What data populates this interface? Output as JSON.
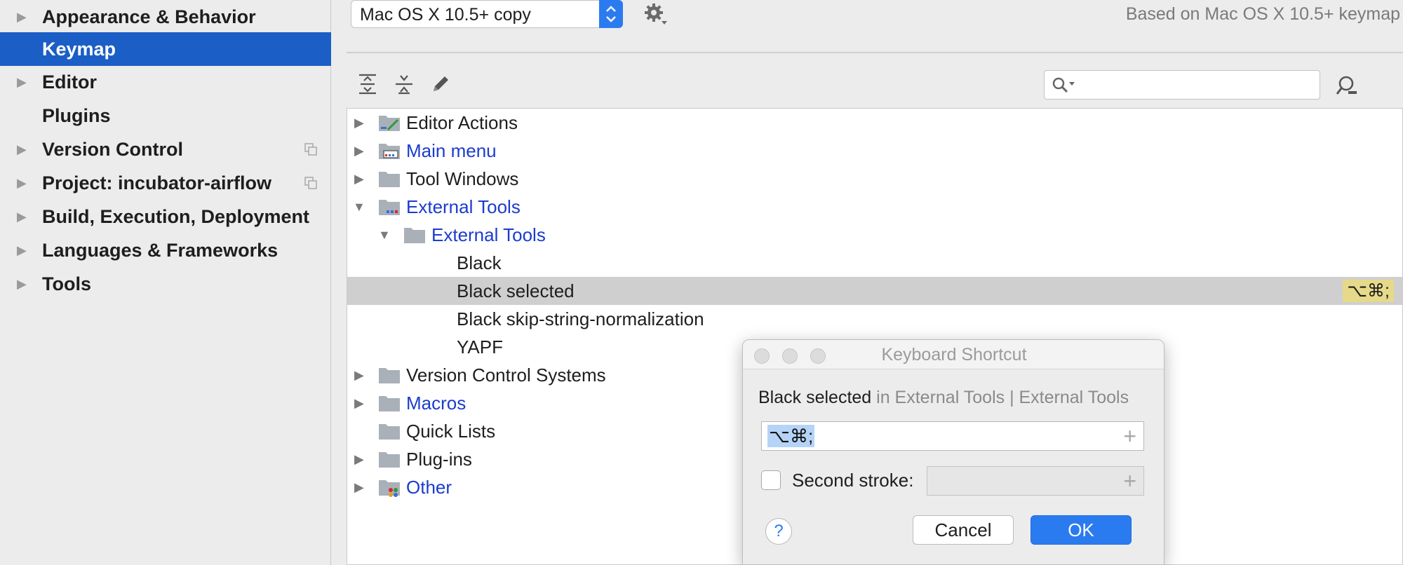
{
  "sidebar": {
    "items": [
      {
        "label": "Appearance & Behavior",
        "expandable": true,
        "selected": false
      },
      {
        "label": "Keymap",
        "expandable": false,
        "selected": true
      },
      {
        "label": "Editor",
        "expandable": true,
        "selected": false
      },
      {
        "label": "Plugins",
        "expandable": false,
        "selected": false
      },
      {
        "label": "Version Control",
        "expandable": true,
        "selected": false,
        "icon": "copy-icon"
      },
      {
        "label": "Project: incubator-airflow",
        "expandable": true,
        "selected": false,
        "icon": "copy-icon"
      },
      {
        "label": "Build, Execution, Deployment",
        "expandable": true,
        "selected": false
      },
      {
        "label": "Languages & Frameworks",
        "expandable": true,
        "selected": false
      },
      {
        "label": "Tools",
        "expandable": true,
        "selected": false
      }
    ]
  },
  "header": {
    "keymap_value": "Mac OS X 10.5+ copy",
    "based_on": "Based on Mac OS X 10.5+ keymap"
  },
  "toolbar": {
    "icons": [
      "expand-all-icon",
      "collapse-all-icon",
      "edit-icon"
    ],
    "search_value": ""
  },
  "tree": {
    "rows": [
      {
        "label": "Editor Actions",
        "link": false,
        "selected": false
      },
      {
        "label": "Main menu",
        "link": true,
        "selected": false
      },
      {
        "label": "Tool Windows",
        "link": false,
        "selected": false
      },
      {
        "label": "External Tools",
        "link": true,
        "selected": false
      },
      {
        "label": "External Tools",
        "link": true,
        "selected": false
      },
      {
        "label": "Black",
        "link": false,
        "selected": false
      },
      {
        "label": "Black selected",
        "link": false,
        "selected": true,
        "shortcut": "⌥⌘;"
      },
      {
        "label": "Black skip-string-normalization",
        "link": false,
        "selected": false
      },
      {
        "label": "YAPF",
        "link": false,
        "selected": false
      },
      {
        "label": "Version Control Systems",
        "link": false,
        "selected": false
      },
      {
        "label": "Macros",
        "link": true,
        "selected": false
      },
      {
        "label": "Quick Lists",
        "link": false,
        "selected": false
      },
      {
        "label": "Plug-ins",
        "link": false,
        "selected": false
      },
      {
        "label": "Other",
        "link": true,
        "selected": false
      }
    ]
  },
  "dialog": {
    "title": "Keyboard Shortcut",
    "action_name": "Black selected",
    "action_context": " in External Tools | External Tools",
    "first_stroke": "⌥⌘;",
    "plus_symbol": "+",
    "second_stroke_label": "Second stroke:",
    "second_stroke_checked": false,
    "help_symbol": "?",
    "cancel_label": "Cancel",
    "ok_label": "OK"
  },
  "colors": {
    "selection": "#1b5ec6",
    "accent": "#2b7bf0",
    "link": "#1a3ccf",
    "shortcut_badge": "#e6d98a"
  }
}
